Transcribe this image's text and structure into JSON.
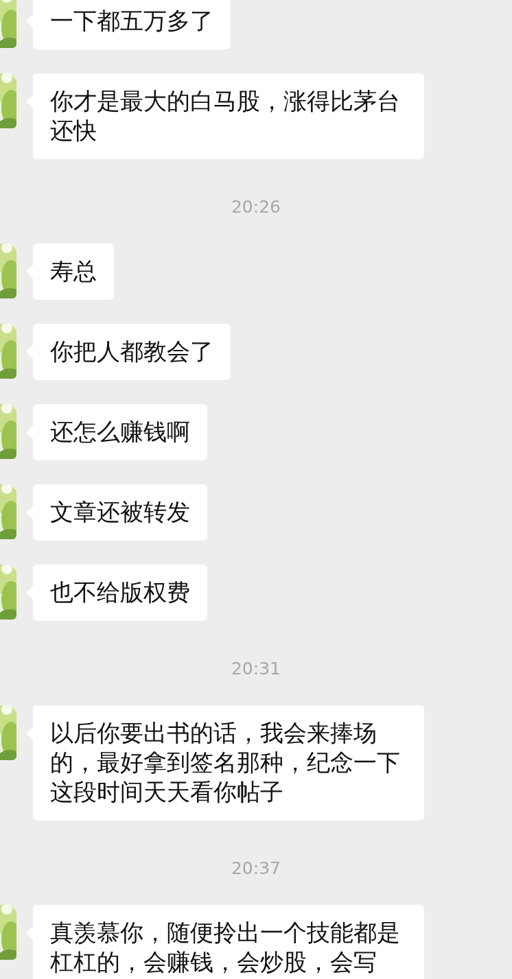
{
  "chat": [
    {
      "kind": "message",
      "text": "一下都五万多了"
    },
    {
      "kind": "message",
      "text": "你才是最大的白马股，涨得比茅台还快"
    },
    {
      "kind": "time",
      "text": "20:26"
    },
    {
      "kind": "message",
      "text": "寿总"
    },
    {
      "kind": "message",
      "text": "你把人都教会了"
    },
    {
      "kind": "message",
      "text": "还怎么赚钱啊"
    },
    {
      "kind": "message",
      "text": "文章还被转发"
    },
    {
      "kind": "message",
      "text": "也不给版权费"
    },
    {
      "kind": "time",
      "text": "20:31"
    },
    {
      "kind": "message",
      "text": "以后你要出书的话，我会来捧场的，最好拿到签名那种，纪念一下这段时间天天看你帖子"
    },
    {
      "kind": "time",
      "text": "20:37"
    },
    {
      "kind": "message",
      "text": "真羡慕你，随便拎出一个技能都是杠杠的，会赚钱，会炒股，会写"
    }
  ]
}
